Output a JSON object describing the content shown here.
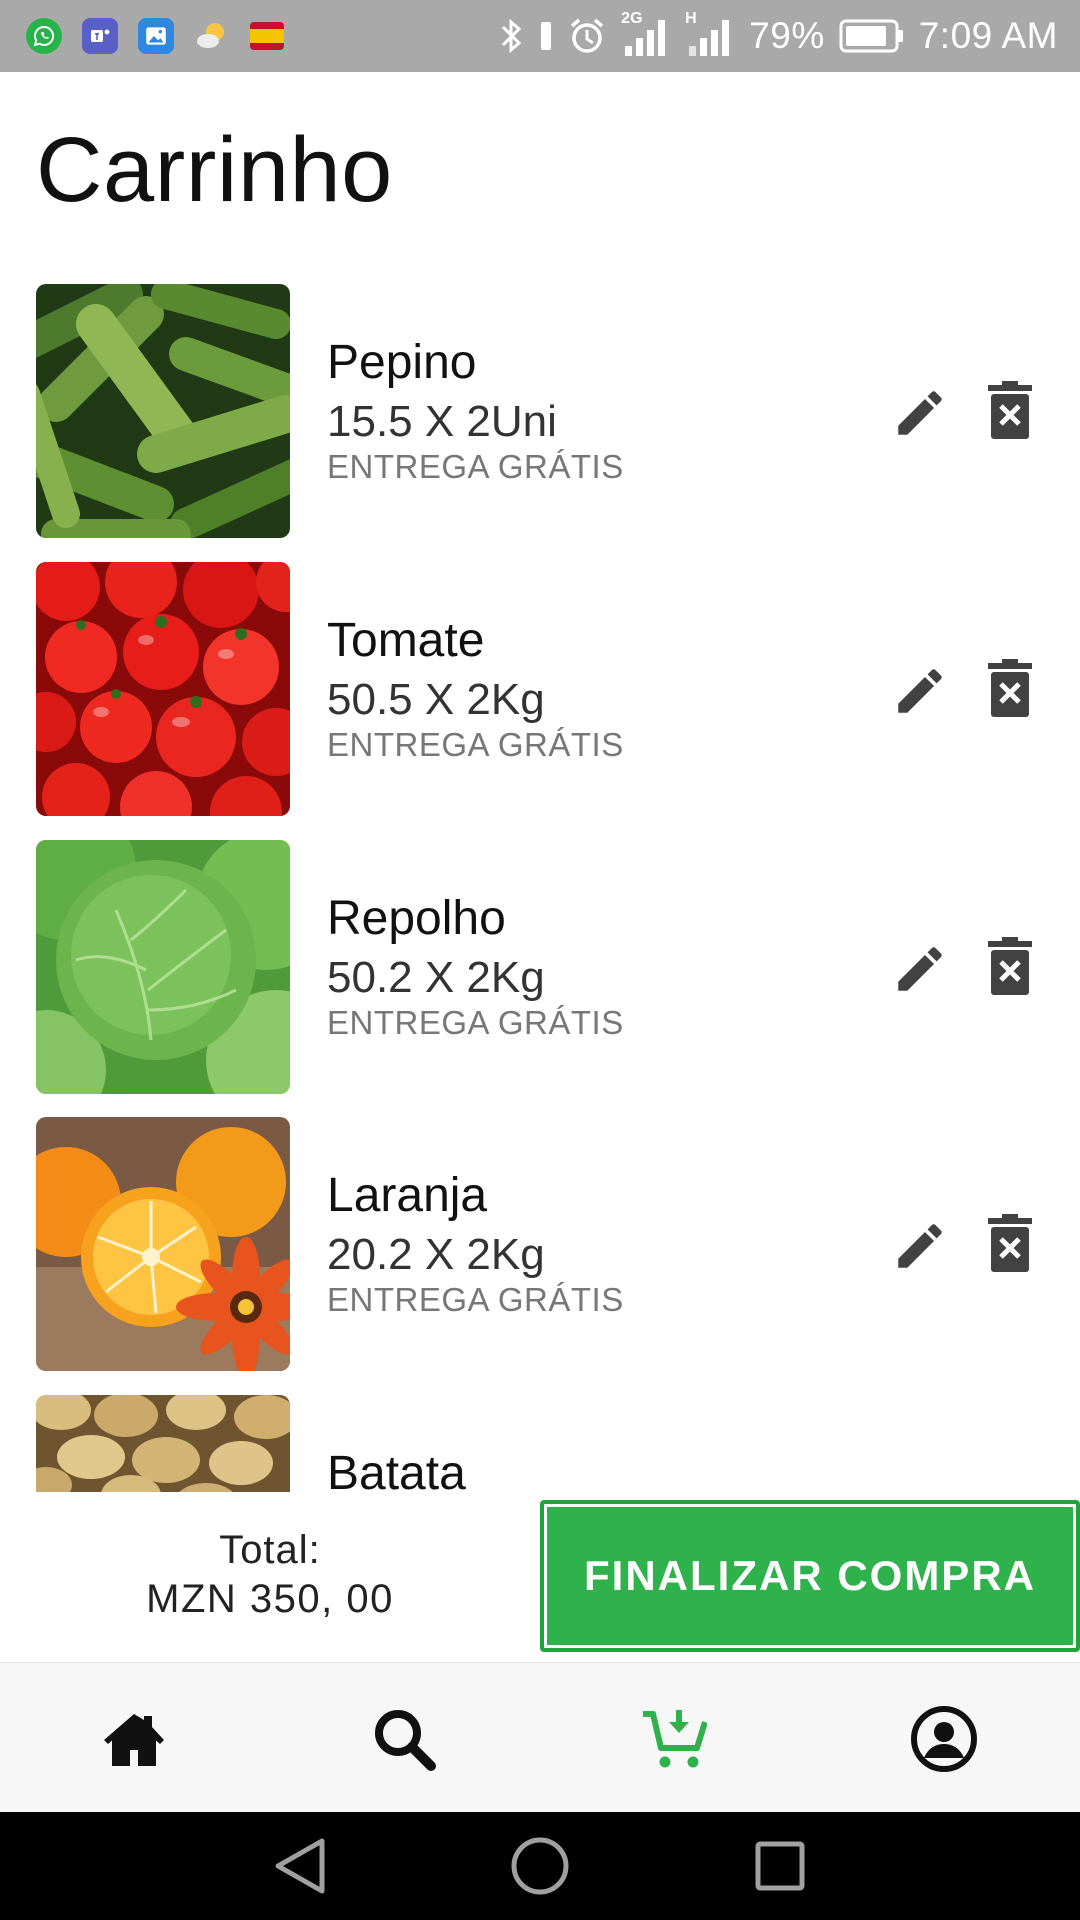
{
  "status_bar": {
    "notifications": [
      "whatsapp-icon",
      "teams-icon",
      "gallery-icon",
      "weather-icon",
      "spain-flag-icon"
    ],
    "network_2g": "2G",
    "network_h": "H",
    "battery_percent": "79%",
    "time": "7:09 AM"
  },
  "page": {
    "title": "Carrinho"
  },
  "cart": {
    "items": [
      {
        "name": "Pepino",
        "quantity": "15.5 X 2Uni",
        "delivery": "ENTREGA GRÁTIS",
        "image": "cucumbers"
      },
      {
        "name": "Tomate",
        "quantity": "50.5 X 2Kg",
        "delivery": "ENTREGA GRÁTIS",
        "image": "tomatoes"
      },
      {
        "name": "Repolho",
        "quantity": "50.2 X 2Kg",
        "delivery": "ENTREGA GRÁTIS",
        "image": "cabbage"
      },
      {
        "name": "Laranja",
        "quantity": "20.2 X 2Kg",
        "delivery": "ENTREGA GRÁTIS",
        "image": "oranges"
      },
      {
        "name": "Batata",
        "image": "potatoes"
      }
    ]
  },
  "checkout": {
    "total_label": "Total:",
    "total_value": "MZN 350, 00",
    "button_label": "FINALIZAR COMPRA"
  },
  "bottom_nav": [
    {
      "icon": "home-icon",
      "active": false
    },
    {
      "icon": "search-icon",
      "active": false
    },
    {
      "icon": "cart-icon",
      "active": true
    },
    {
      "icon": "profile-icon",
      "active": false
    }
  ],
  "colors": {
    "accent": "#2fb14b",
    "status_bar": "#a9a9a9",
    "icon_dark": "#424242",
    "text_muted": "#777777"
  }
}
